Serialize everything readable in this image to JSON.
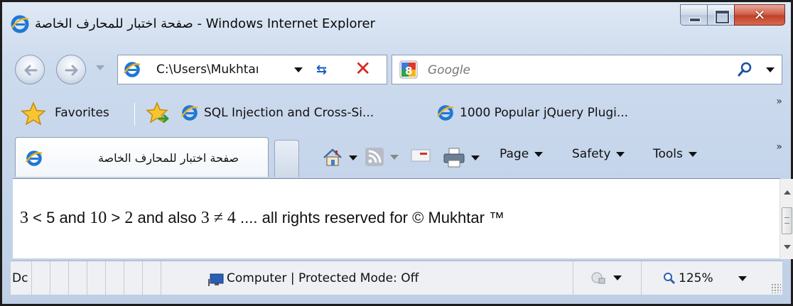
{
  "window": {
    "title": "صفحة اختبار للمحارف الخاصة - Windows Internet Explorer"
  },
  "address_bar": {
    "url": "C:\\Users\\Mukhtaı"
  },
  "search": {
    "placeholder": "Google"
  },
  "favorites_bar": {
    "favorites_label": "Favorites",
    "links": [
      {
        "label": "SQL Injection and Cross-Si..."
      },
      {
        "label": "1000 Popular jQuery Plugi..."
      }
    ],
    "more": "»"
  },
  "tab": {
    "label": "صفحة اختبار للمحارف الخاصة"
  },
  "command_bar": {
    "page_label": "Page",
    "safety_label": "Safety",
    "tools_label": "Tools",
    "more": "»"
  },
  "content": {
    "parts": [
      "3",
      " < ",
      "5",
      " and ",
      "10",
      " > ",
      "2",
      " and also ",
      "3",
      " ≠ ",
      "4",
      " .... all rights reserved for © Mukhtar ™"
    ]
  },
  "status_bar": {
    "text": "Dc",
    "zone": "Computer | Protected Mode: Off",
    "zoom": "125%"
  },
  "colors": {
    "chrome_top": "#dfe9f5",
    "chrome_bottom": "#bfcfe6",
    "close_button": "#c1412a",
    "link_blue": "#1b5bbf"
  }
}
